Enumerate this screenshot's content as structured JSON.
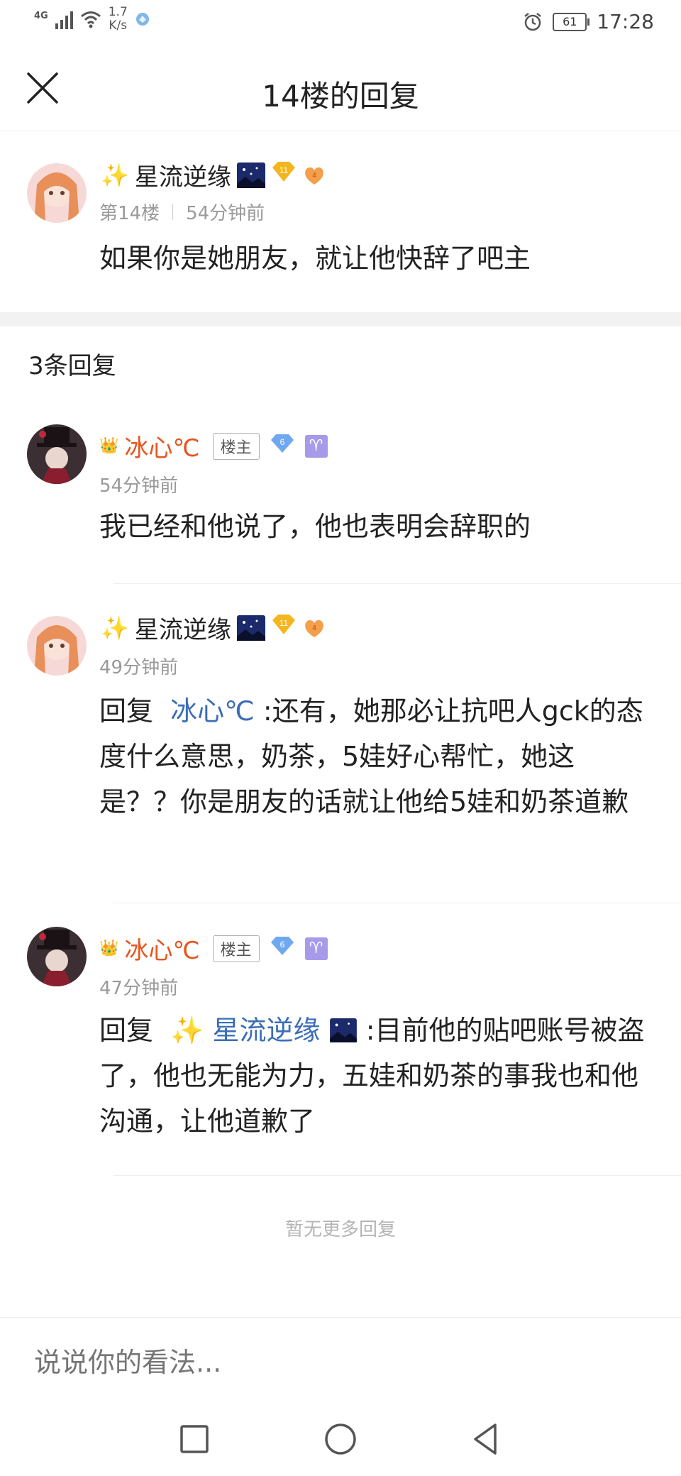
{
  "status_bar": {
    "network_type": "4G",
    "speed_value": "1.7",
    "speed_unit": "K/s",
    "battery": "61",
    "time": "17:28"
  },
  "header": {
    "title": "14楼的回复"
  },
  "floor_post": {
    "username": "星流逆缘",
    "level": "11",
    "floor": "第14楼",
    "time": "54分钟前",
    "content": "如果你是她朋友，就让他快辞了吧主"
  },
  "replies_header": "3条回复",
  "replies": [
    {
      "username": "冰心℃",
      "owner_badge": "楼主",
      "level": "6",
      "zodiac": "♈",
      "time": "54分钟前",
      "content": "我已经和他说了，他也表明会辞职的"
    },
    {
      "username": "星流逆缘",
      "level": "11",
      "time": "49分钟前",
      "reply_prefix": "回复",
      "mention": "冰心℃",
      "content": " :还有，她那必让抗吧人gck的态度什么意思，奶茶，5娃好心帮忙，她这是？？你是朋友的话就让他给5娃和奶茶道歉"
    },
    {
      "username": "冰心℃",
      "owner_badge": "楼主",
      "level": "6",
      "zodiac": "♈",
      "time": "47分钟前",
      "reply_prefix": "回复",
      "mention": "星流逆缘",
      "content": " :目前他的贴吧账号被盗了，他也无能为力，五娃和奶茶的事我也和他沟通，让他道歉了"
    }
  ],
  "no_more": "暂无更多回复",
  "comment_placeholder": "说说你的看法...",
  "colors": {
    "owner_name": "#e8541e",
    "mention": "#3b6db6",
    "meta": "#9a9a9a"
  }
}
